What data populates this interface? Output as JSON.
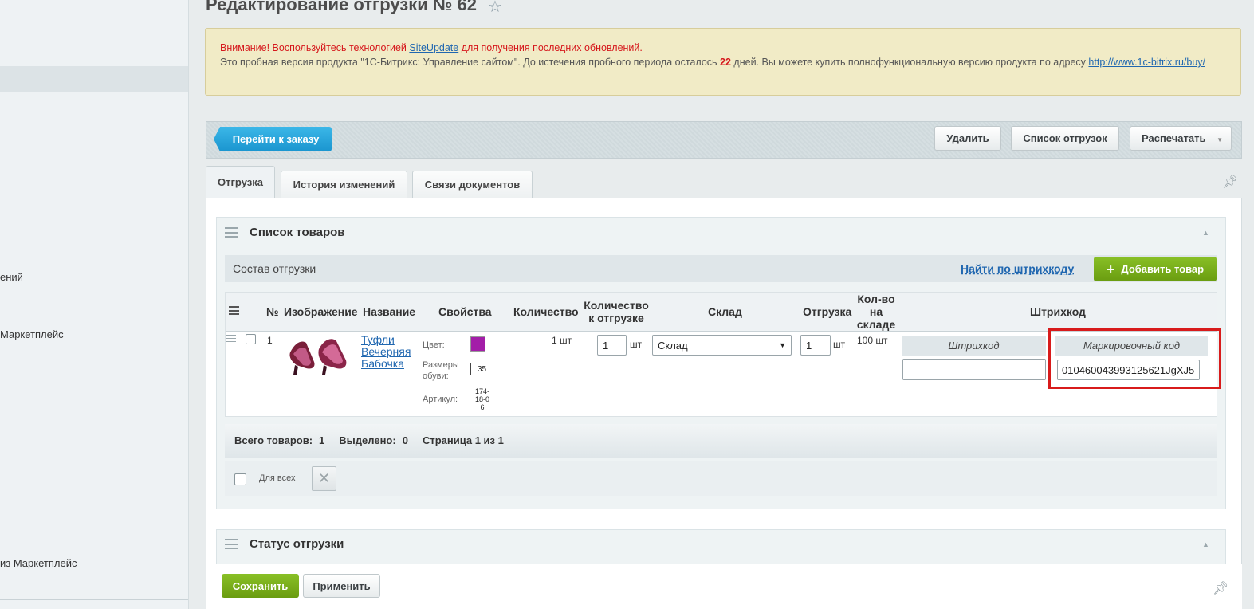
{
  "sidebar": {
    "fragments": [
      "ений",
      "Маркетплейс",
      "из Маркетплейс"
    ]
  },
  "header": {
    "title": "Редактирование отгрузки № 62"
  },
  "notice": {
    "warning_prefix": "Внимание! Воспользуйтесь технологией ",
    "warning_link": "SiteUpdate",
    "warning_suffix": " для получения последних обновлений.",
    "info_prefix": "Это пробная версия продукта \"1С-Битрикс: Управление сайтом\". До истечения пробного периода осталось ",
    "days": "22",
    "info_middle": " дней. Вы можете купить полнофункциональную версию продукта по адресу ",
    "info_link": "http://www.1c-bitrix.ru/buy/"
  },
  "toolbar": {
    "goto_order": "Перейти к заказу",
    "delete": "Удалить",
    "shipments_list": "Список отгрузок",
    "print": "Распечатать"
  },
  "tabs": [
    {
      "label": "Отгрузка"
    },
    {
      "label": "История изменений"
    },
    {
      "label": "Связи документов"
    }
  ],
  "products_panel": {
    "title": "Список товаров",
    "composition_title": "Состав отгрузки",
    "find_by_barcode": "Найти по штрихкоду",
    "add_product": "Добавить товар",
    "columns": {
      "num": "№",
      "image": "Изображение",
      "name": "Название",
      "properties": "Свойства",
      "quantity": "Количество",
      "qty_to_ship": "Количество к отгрузке",
      "warehouse": "Склад",
      "shipment": "Отгрузка",
      "stock": "Кол-во на складе",
      "barcode": "Штрихкод"
    },
    "row": {
      "num": "1",
      "name": "Туфли Вечерняя Бабочка",
      "prop_color_label": "Цвет:",
      "color_hex": "#a31ea8",
      "prop_size_label": "Размеры обуви:",
      "prop_size_value": "35",
      "prop_article_label": "Артикул:",
      "prop_article_value": "174-18-06",
      "quantity": "1 шт",
      "qty_to_ship": "1",
      "qty_unit": "шт",
      "warehouse": "Склад",
      "shipment_qty": "1",
      "shipment_unit": "шт",
      "stock": "100 шт",
      "barcode_header": "Штрихкод",
      "barcode_value": "",
      "mark_code_header": "Маркировочный код",
      "mark_code_value": "010460043993125621JgXJ5"
    },
    "summary": {
      "total_label": "Всего товаров:",
      "total_value": "1",
      "selected_label": "Выделено:",
      "selected_value": "0",
      "page_label": "Страница 1 из 1"
    },
    "for_all": "Для всех"
  },
  "status_panel": {
    "title": "Статус отгрузки"
  },
  "bottom": {
    "save": "Сохранить",
    "apply": "Применить"
  }
}
